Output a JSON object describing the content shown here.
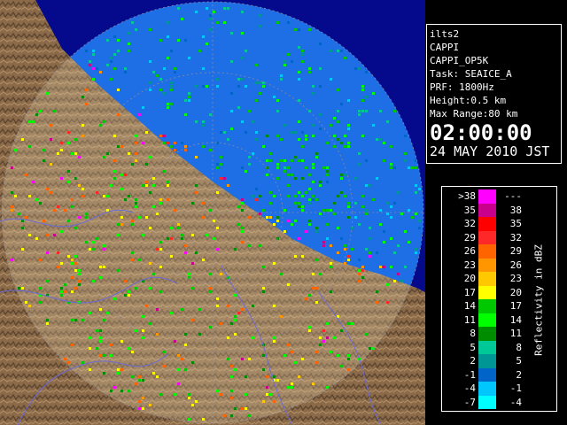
{
  "info": {
    "radar_name": "ilts2",
    "product": "CAPPI",
    "product_id": "CAPPI_OP5K",
    "task": "Task: SEAICE_A",
    "prf": "PRF: 1800Hz",
    "height": "Height:0.5 km",
    "max_range": "Max Range:80 km",
    "time": "02:00:00",
    "date": "24 MAY 2010 JST"
  },
  "legend": {
    "title": "Reflectivity in dBZ",
    "rows": [
      {
        "lo": ">38",
        "hi": "---",
        "color": "#ff00ff"
      },
      {
        "lo": "35",
        "hi": "38",
        "color": "#c8008c"
      },
      {
        "lo": "32",
        "hi": "35",
        "color": "#ff0000"
      },
      {
        "lo": "29",
        "hi": "32",
        "color": "#ff2828"
      },
      {
        "lo": "26",
        "hi": "29",
        "color": "#ff6400"
      },
      {
        "lo": "23",
        "hi": "26",
        "color": "#ff9600"
      },
      {
        "lo": "20",
        "hi": "23",
        "color": "#ffc800"
      },
      {
        "lo": "17",
        "hi": "20",
        "color": "#ffff00"
      },
      {
        "lo": "14",
        "hi": "17",
        "color": "#00c800"
      },
      {
        "lo": "11",
        "hi": "14",
        "color": "#00ff00"
      },
      {
        "lo": "8",
        "hi": "11",
        "color": "#008c00"
      },
      {
        "lo": "5",
        "hi": "8",
        "color": "#00c896"
      },
      {
        "lo": "2",
        "hi": "5",
        "color": "#009696"
      },
      {
        "lo": "-1",
        "hi": "2",
        "color": "#0064c8"
      },
      {
        "lo": "-4",
        "hi": "-1",
        "color": "#00c8ff"
      },
      {
        "lo": "-7",
        "hi": "-4",
        "color": "#00ffff"
      }
    ]
  }
}
